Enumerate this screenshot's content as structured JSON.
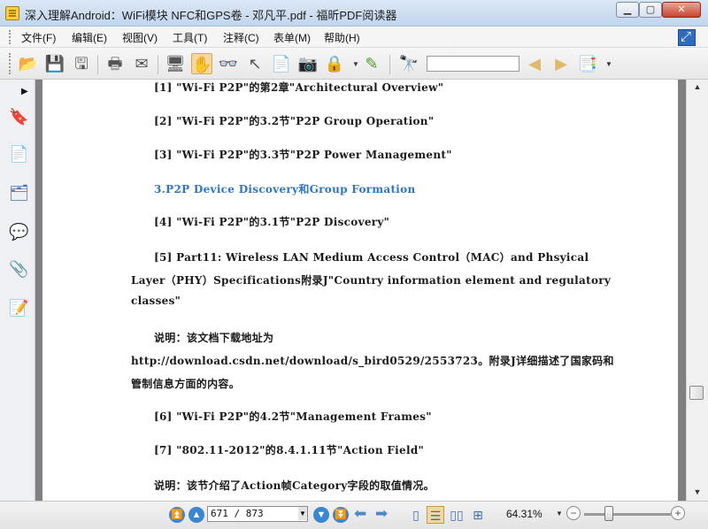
{
  "window": {
    "title": "深入理解Android：WiFi模块 NFC和GPS卷 - 邓凡平.pdf - 福昕PDF阅读器",
    "minimize": "▁",
    "maximize": "▢",
    "close": "✕"
  },
  "menu": {
    "items": [
      "文件(F)",
      "编辑(E)",
      "视图(V)",
      "工具(T)",
      "注释(C)",
      "表单(M)",
      "帮助(H)"
    ]
  },
  "toolbar": {
    "search_placeholder": ""
  },
  "document": {
    "lines": [
      "[1]  \"Wi-Fi P2P\"的第2章\"Architectural Overview\"",
      "[2]  \"Wi-Fi P2P\"的3.2节\"P2P Group Operation\"",
      "[3]  \"Wi-Fi P2P\"的3.3节\"P2P Power Management\"",
      "3.P2P Device Discovery和Group Formation",
      "[4]  \"Wi-Fi P2P\"的3.1节\"P2P Discovery\"",
      "[5]  Part11: Wireless LAN Medium Access Control（MAC）and Phsyical",
      "Layer（PHY）Specifications附录J\"Country information element and regulatory",
      "classes\"",
      "说明：该文档下载地址为",
      "http://download.csdn.net/download/s_bird0529/2553723。附录J详细描述了国家码和",
      "管制信息方面的内容。",
      "[6]  \"Wi-Fi P2P\"的4.2节\"Management Frames\"",
      "[7]  \"802.11-2012\"的8.4.1.11节\"Action Field\"",
      "说明：该节介绍了Action帧Category字段的取值情况。"
    ]
  },
  "navigation": {
    "page_value": "671 / 873",
    "zoom": "64.31%",
    "zoom_level_fraction": 0.27
  },
  "colors": {
    "heading": "#2c76c6",
    "active_tool": "#f3d8a1",
    "accent": "#2f6bbf"
  }
}
